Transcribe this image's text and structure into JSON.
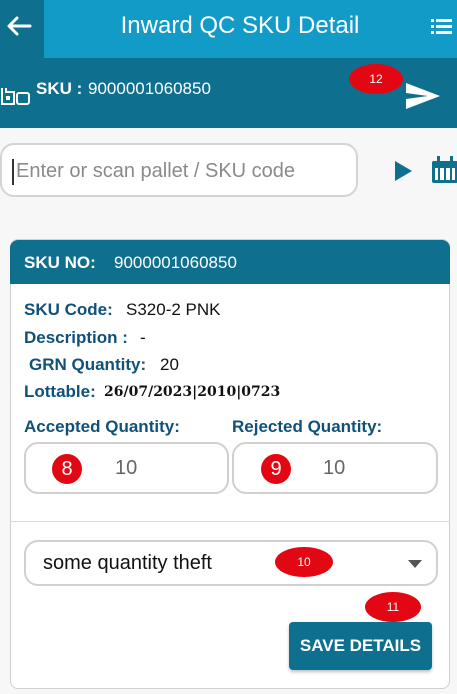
{
  "header": {
    "title": "Inward QC SKU Detail"
  },
  "sku_bar": {
    "label": "SKU :",
    "value": "9000001060850",
    "badge": "12"
  },
  "search": {
    "placeholder": "Enter or scan pallet / SKU code"
  },
  "card": {
    "header_label": "SKU NO:",
    "header_value": "9000001060850",
    "fields": {
      "sku_code_label": "SKU Code:",
      "sku_code_value": "S320-2 PNK",
      "description_label": "Description :",
      "description_value": "-",
      "grn_label": "GRN Quantity:",
      "grn_value": "20",
      "lottable_label": "Lottable:",
      "lottable_value": "26/07/2023|2010|0723"
    },
    "accepted": {
      "label": "Accepted Quantity:",
      "value": "10",
      "badge": "8"
    },
    "rejected": {
      "label": "Rejected Quantity:",
      "value": "10",
      "badge": "9"
    },
    "reason": {
      "value": "some quantity theft",
      "badge": "10"
    },
    "save": {
      "label": "SAVE DETAILS",
      "badge": "11"
    }
  },
  "colors": {
    "primary": "#139bc8",
    "primary_dark": "#0e6f8e",
    "label_blue": "#10517a",
    "badge_red": "#e30613"
  }
}
